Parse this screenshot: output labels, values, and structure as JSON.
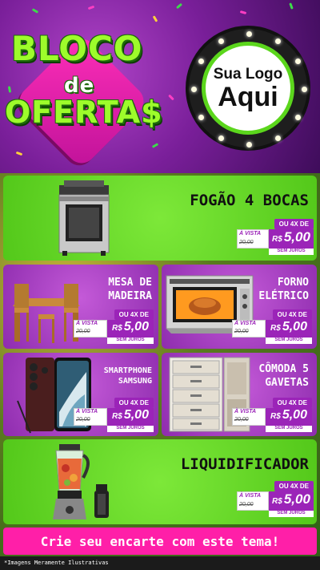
{
  "header": {
    "title_line1": "BLOCO",
    "title_line2": "de",
    "title_line3": "OFERTA$",
    "logo_line1": "Sua Logo",
    "logo_line2": "Aqui"
  },
  "products": [
    {
      "name": "FOGÃO 4 BOCAS",
      "icon": "stove-icon",
      "installments": "OU 4X DE",
      "cash_label": "À VISTA",
      "old_price": "20,00",
      "currency": "R$",
      "price": "5,00",
      "no_interest": "SEM JUROS"
    },
    {
      "name_l1": "MESA DE",
      "name_l2": "MADEIRA",
      "icon": "dining-table-icon",
      "installments": "OU 4X DE",
      "cash_label": "À VISTA",
      "old_price": "20,00",
      "currency": "R$",
      "price": "5,00",
      "no_interest": "SEM JUROS"
    },
    {
      "name_l1": "FORNO",
      "name_l2": "ELÉTRICO",
      "icon": "electric-oven-icon",
      "installments": "OU 4X DE",
      "cash_label": "À VISTA",
      "old_price": "20,00",
      "currency": "R$",
      "price": "5,00",
      "no_interest": "SEM JUROS"
    },
    {
      "name_l1": "SMARTPHONE",
      "name_l2": "SAMSUNG",
      "icon": "smartphone-icon",
      "installments": "OU 4X DE",
      "cash_label": "À VISTA",
      "old_price": "20,00",
      "currency": "R$",
      "price": "5,00",
      "no_interest": "SEM JUROS"
    },
    {
      "name_l1": "CÔMODA 5",
      "name_l2": "GAVETAS",
      "icon": "dresser-icon",
      "installments": "OU 4X DE",
      "cash_label": "À VISTA",
      "old_price": "20,00",
      "currency": "R$",
      "price": "5,00",
      "no_interest": "SEM JUROS"
    },
    {
      "name": "LIQUIDIFICADOR",
      "icon": "blender-icon",
      "installments": "OU 4X DE",
      "cash_label": "À VISTA",
      "old_price": "20,00",
      "currency": "R$",
      "price": "5,00",
      "no_interest": "SEM JUROS"
    }
  ],
  "banner": "Crie seu encarte com este tema!",
  "disclaimer": "*Imagens Meramente Ilustrativas",
  "colors": {
    "green": "#5bd61c",
    "purple": "#9b24b8",
    "pink": "#ff1fa8"
  }
}
